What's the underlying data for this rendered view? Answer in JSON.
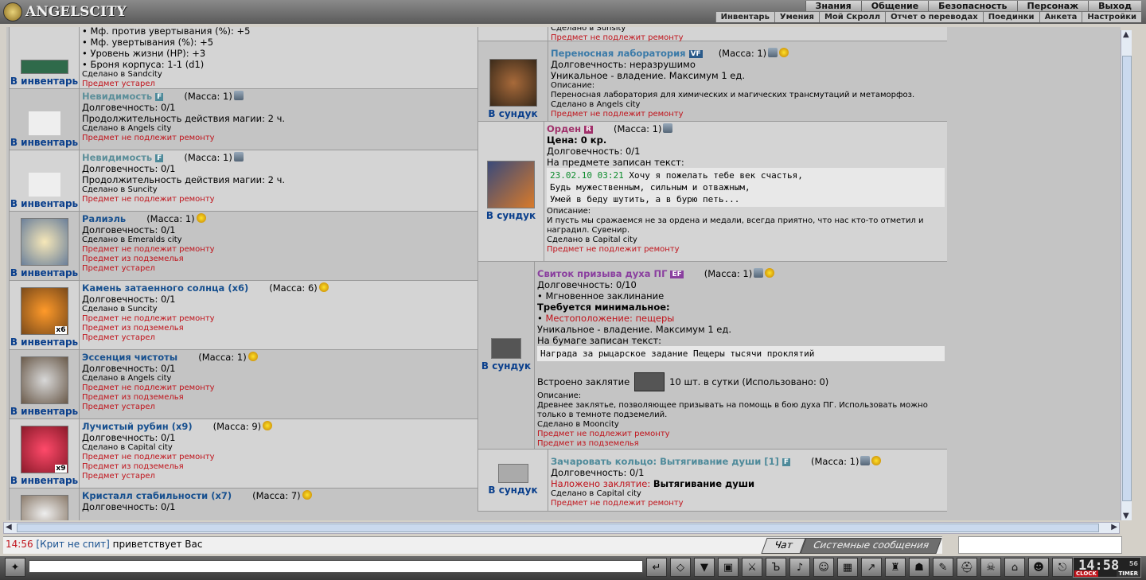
{
  "header": {
    "logo_text": "ANGELSCITY",
    "nav_primary": [
      "Знания",
      "Общение",
      "Безопасность",
      "Персонаж",
      "Выход"
    ],
    "nav_secondary": [
      "Инвентарь",
      "Умения",
      "Мой Скролл",
      "Отчет о переводах",
      "Поединки",
      "Анкета",
      "Настройки"
    ]
  },
  "labels": {
    "to_inventory": "В инвентарь",
    "to_chest": "В сундук"
  },
  "left_items": [
    {
      "lines": [
        "• Мф. против увертывания (%): +5",
        "• Мф. увертывания (%): +5",
        "• Уровень жизни (HP): +3",
        "• Броня корпуса: 1-1 (d1)"
      ],
      "made": "Сделано в Sandcity",
      "flags": [
        "Предмет устарел"
      ]
    },
    {
      "name": "Невидимость",
      "badge": "F",
      "mass": "(Масса: 1)",
      "lines": [
        "Долговечность: 0/1",
        "Продолжительность действия магии: 2 ч."
      ],
      "made": "Сделано в Angels city",
      "flags": [
        "Предмет не подлежит ремонту"
      ]
    },
    {
      "name": "Невидимость",
      "badge": "F",
      "mass": "(Масса: 1)",
      "lines": [
        "Долговечность: 0/1",
        "Продолжительность действия магии: 2 ч."
      ],
      "made": "Сделано в Suncity",
      "flags": [
        "Предмет не подлежит ремонту"
      ]
    },
    {
      "name": "Ралиэль",
      "mass": "(Масса: 1)",
      "lines": [
        "Долговечность: 0/1"
      ],
      "made": "Сделано в Emeralds city",
      "flags": [
        "Предмет не подлежит ремонту",
        "Предмет из подземелья",
        "Предмет устарел"
      ]
    },
    {
      "name": "Камень затаенного солнца (x6)",
      "mass": "(Масса: 6)",
      "count": "x6",
      "lines": [
        "Долговечность: 0/1"
      ],
      "made": "Сделано в Suncity",
      "flags": [
        "Предмет не подлежит ремонту",
        "Предмет из подземелья",
        "Предмет устарел"
      ]
    },
    {
      "name": "Эссенция чистоты",
      "mass": "(Масса: 1)",
      "lines": [
        "Долговечность: 0/1"
      ],
      "made": "Сделано в Angels city",
      "flags": [
        "Предмет не подлежит ремонту",
        "Предмет из подземелья",
        "Предмет устарел"
      ]
    },
    {
      "name": "Лучистый рубин (x9)",
      "mass": "(Масса: 9)",
      "count": "x9",
      "lines": [
        "Долговечность: 0/1"
      ],
      "made": "Сделано в Capital city",
      "flags": [
        "Предмет не подлежит ремонту",
        "Предмет из подземелья",
        "Предмет устарел"
      ]
    },
    {
      "name": "Кристалл стабильности (x7)",
      "mass": "(Масса: 7)",
      "lines": [
        "Долговечность: 0/1"
      ],
      "made": "",
      "flags": []
    }
  ],
  "right_items": {
    "top_partial": {
      "made": "Сделано в Sunsity",
      "flag": "Предмет не подлежит ремонту"
    },
    "lab": {
      "name": "Переносная лаборатория",
      "badge": "VF",
      "mass": "(Масса: 1)",
      "lines": [
        "Долговечность: неразрушимо",
        "Уникальное - владение. Максимум 1 ед."
      ],
      "desc_label": "Описание:",
      "desc": "Переносная лаборатория для химических и магических трансмутаций и метаморфоз.",
      "made": "Сделано в Angels city",
      "flag": "Предмет не подлежит ремонту"
    },
    "order": {
      "name": "Орден",
      "badge": "R",
      "mass": "(Масса: 1)",
      "price": "Цена: 0 кр.",
      "lines": [
        "Долговечность: 0/1",
        "На предмете записан текст:"
      ],
      "note_time": "23.02.10 03:21",
      "note_text": [
        " Хочу я пожелать тебе век счастья,",
        "Будь мужественным, сильным и отважным,",
        "Умей в беду шутить, а в бурю петь..."
      ],
      "desc_label": "Описание:",
      "desc": "И пусть мы сражаемся не за ордена и медали, всегда приятно, что нас кто-то отметил и наградил. Сувенир.",
      "made": "Сделано в Capital city",
      "flag": "Предмет не подлежит ремонту"
    },
    "scroll": {
      "name": "Свиток призыва духа ПГ",
      "badge": "EF",
      "mass": "(Масса: 1)",
      "lines": [
        "Долговечность: 0/10",
        "• Мгновенное заклинание"
      ],
      "req": "Требуется минимальное:",
      "req_line_prefix": "• ",
      "req_line": "Местоположение: пещеры",
      "unique": "Уникальное - владение. Максимум 1 ед.",
      "paper_label": "На бумаге записан текст:",
      "paper": "Награда за рыцарское задание Пещеры тысячи проклятий",
      "spell_prefix": "Встроено заклятие",
      "spell_suffix": "10 шт. в сутки (Использовано: 0)",
      "desc_label": "Описание:",
      "desc": "Древнее заклятье, позволяющее призывать на помощь в бою духа ПГ. Использовать можно только в темноте подземелий.",
      "made": "Сделано в Mooncity",
      "flags": [
        "Предмет не подлежит ремонту",
        "Предмет из подземелья"
      ]
    },
    "ring": {
      "name": "Зачаровать кольцо: Вытягивание души [1]",
      "badge": "F",
      "mass": "(Масса: 1)",
      "lines": [
        "Долговечность: 0/1"
      ],
      "spell_label": "Наложено заклятие:",
      "spell_name": "Вытягивание души",
      "made": "Сделано в Capital city",
      "flag": "Предмет не подлежит ремонту"
    }
  },
  "chat": {
    "time": "14:56",
    "user": "[Крит не спит]",
    "text": " приветствует Вас",
    "tab_chat": "Чат",
    "tab_system": "Системные сообщения"
  },
  "clock": {
    "time": "14:58",
    "seconds": "56",
    "label_clock": "CLOCK",
    "label_timer": "TIMER"
  },
  "toolbar_icons": [
    "send-icon",
    "eraser-icon",
    "filter-icon",
    "save-icon",
    "hide-icon",
    "text-size-icon",
    "sound-icon",
    "smile-icon",
    "lock-icon",
    "arrow-icon",
    "potion-icon",
    "creature-icon",
    "quill-icon",
    "helmet-icon",
    "mask-icon",
    "home-icon",
    "group-icon",
    "exit-icon"
  ]
}
